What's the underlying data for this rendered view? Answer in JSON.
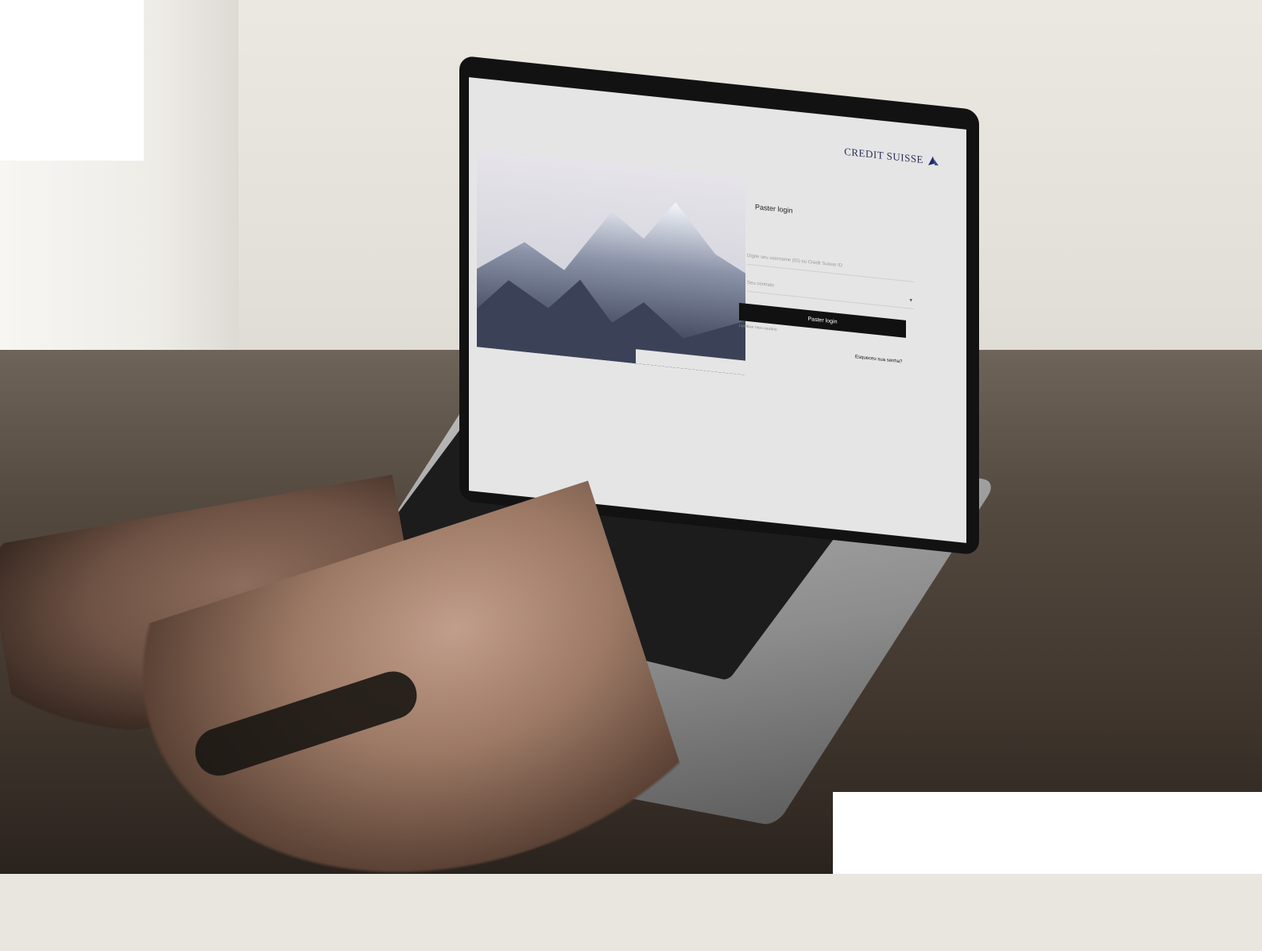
{
  "screen": {
    "brand": "CREDIT SUISSE",
    "login_title": "Paster login",
    "username_placeholder": "Digite seu username (ID) ou Credit Suisse ID",
    "contract_placeholder": "Seu contrato",
    "login_button_label": "Paster login",
    "remember_text": "Lembrar meu usuário",
    "forgot_text": "Esqueceu sua senha?"
  }
}
